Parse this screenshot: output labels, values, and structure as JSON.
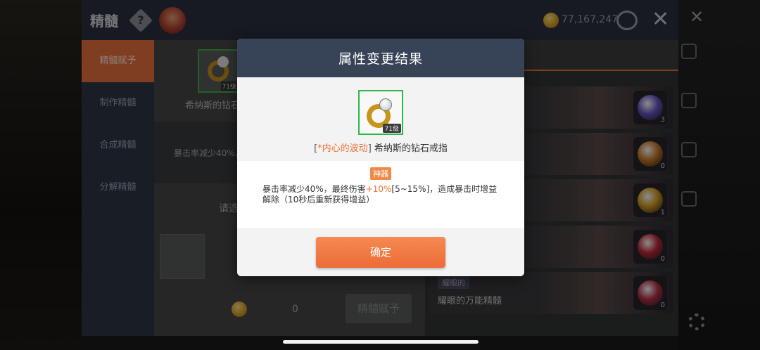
{
  "window": {
    "title": "精髓",
    "help_glyph": "?",
    "coins": "77,167,247",
    "close_glyph": "✕"
  },
  "sidebar": {
    "items": [
      {
        "label": "精髓赋予",
        "active": true
      },
      {
        "label": "制作精髓",
        "active": false
      },
      {
        "label": "合成精髓",
        "active": false
      },
      {
        "label": "分解精髓",
        "active": false
      }
    ]
  },
  "content": {
    "item_level": "71级",
    "item_name": "希纳斯的钻石",
    "effect_preview": "暴击率减少40%，",
    "select_hint": "请选",
    "cost": "0",
    "grant_button": "精髓赋予"
  },
  "right_panel": {
    "cards": [
      {
        "count": "3",
        "orb_color": "#6a55c8"
      },
      {
        "count": "0",
        "orb_color": "#c87a28"
      },
      {
        "count": "1",
        "orb_color": "#d49a20"
      },
      {
        "count": "0",
        "orb_color": "#c0283a"
      },
      {
        "badge": "耀眼的",
        "name": "耀眼的万能精髓",
        "count": "0",
        "orb_color": "#b83048"
      }
    ]
  },
  "modal": {
    "title": "属性变更结果",
    "item_level": "71级",
    "bracket_open": "[",
    "potential_name": "*内心的波动",
    "bracket_close": "]",
    "item_name": " 希纳斯的钻石戒指",
    "tier_badge": "神器",
    "effect_part1": "暴击率减少40%，最终伤害",
    "effect_highlight": "+10%",
    "effect_part2": "[5~15%]，造成暴击时增益解除（10秒后重新获得增益）",
    "confirm_button": "确定"
  },
  "colors": {
    "accent": "#ec6c38",
    "frame_green": "#2fb84a",
    "modal_header": "#374458",
    "tier": "#f08a4a"
  }
}
